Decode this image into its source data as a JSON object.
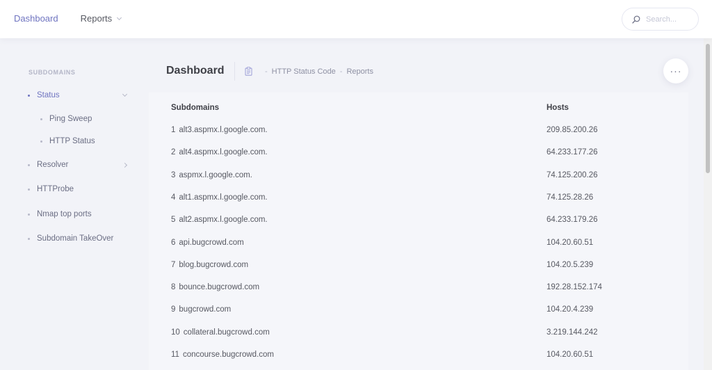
{
  "header": {
    "nav": [
      {
        "label": "Dashboard"
      },
      {
        "label": "Reports"
      }
    ],
    "search_placeholder": "Search..."
  },
  "sidebar": {
    "section_title": "SUBDOMAINS",
    "items": [
      {
        "label": "Status"
      },
      {
        "label": "Ping Sweep"
      },
      {
        "label": "HTTP Status"
      },
      {
        "label": "Resolver"
      },
      {
        "label": "HTTProbe"
      },
      {
        "label": "Nmap top ports"
      },
      {
        "label": "Subdomain TakeOver"
      }
    ]
  },
  "main": {
    "title": "Dashboard",
    "breadcrumb": [
      "HTTP Status Code",
      "Reports"
    ],
    "more_label": "···",
    "table": {
      "headers": [
        "Subdomains",
        "Hosts"
      ],
      "rows": [
        {
          "n": "1",
          "subdomain": "alt3.aspmx.l.google.com.",
          "host": "209.85.200.26"
        },
        {
          "n": "2",
          "subdomain": "alt4.aspmx.l.google.com.",
          "host": "64.233.177.26"
        },
        {
          "n": "3",
          "subdomain": "aspmx.l.google.com.",
          "host": "74.125.200.26"
        },
        {
          "n": "4",
          "subdomain": "alt1.aspmx.l.google.com.",
          "host": "74.125.28.26"
        },
        {
          "n": "5",
          "subdomain": "alt2.aspmx.l.google.com.",
          "host": "64.233.179.26"
        },
        {
          "n": "6",
          "subdomain": "api.bugcrowd.com",
          "host": "104.20.60.51"
        },
        {
          "n": "7",
          "subdomain": "blog.bugcrowd.com",
          "host": "104.20.5.239"
        },
        {
          "n": "8",
          "subdomain": "bounce.bugcrowd.com",
          "host": "192.28.152.174"
        },
        {
          "n": "9",
          "subdomain": "bugcrowd.com",
          "host": "104.20.4.239"
        },
        {
          "n": "10",
          "subdomain": "collateral.bugcrowd.com",
          "host": "3.219.144.242"
        },
        {
          "n": "11",
          "subdomain": "concourse.bugcrowd.com",
          "host": "104.20.60.51"
        }
      ]
    }
  },
  "colors": {
    "accent": "#6f74c0",
    "background": "#f2f3f8",
    "text": "#575962"
  }
}
